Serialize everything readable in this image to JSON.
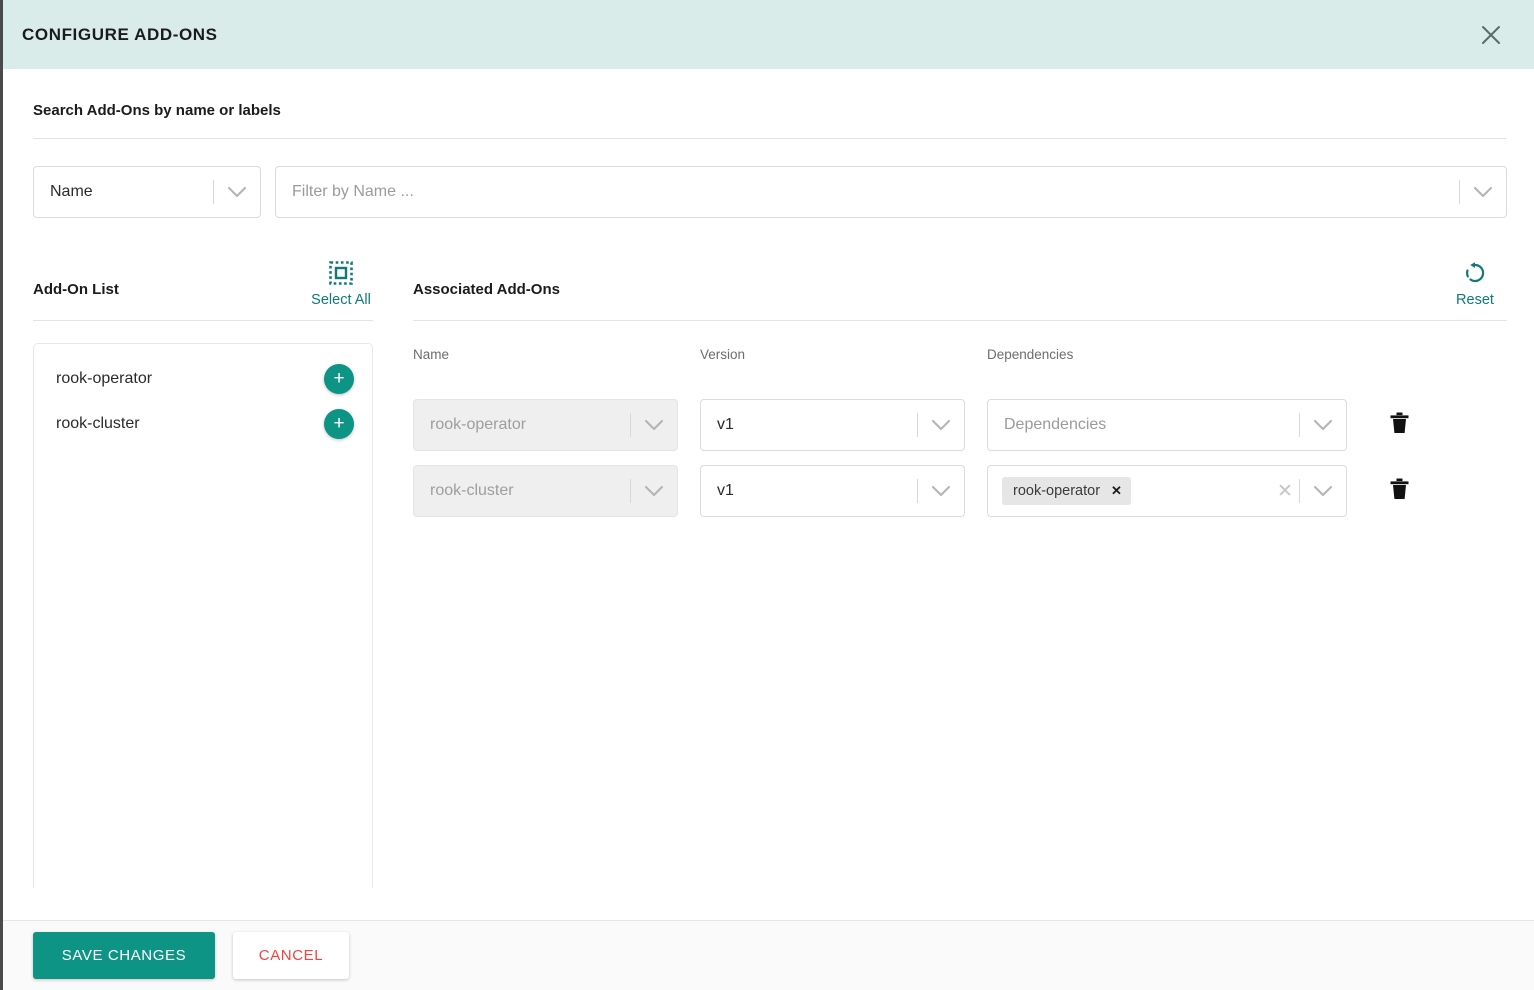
{
  "header": {
    "title": "CONFIGURE ADD-ONS",
    "close_icon": "close-icon"
  },
  "search": {
    "section_label": "Search Add-Ons by name or labels",
    "criteria_value": "Name",
    "criteria_caret_icon": "chevron-down-icon",
    "filter_placeholder": "Filter by Name ...",
    "filter_value": "",
    "filter_caret_icon": "chevron-down-icon"
  },
  "addon_list": {
    "title": "Add-On List",
    "select_all_label": "Select All",
    "select_all_icon": "select-all-icon",
    "items": [
      {
        "name": "rook-operator",
        "add_icon": "plus-icon"
      },
      {
        "name": "rook-cluster",
        "add_icon": "plus-icon"
      }
    ]
  },
  "associated": {
    "title": "Associated Add-Ons",
    "reset_label": "Reset",
    "reset_icon": "reset-icon",
    "columns": {
      "name": "Name",
      "version": "Version",
      "dependencies": "Dependencies"
    },
    "delete_icon": "trash-icon",
    "rows": [
      {
        "name": "rook-operator",
        "name_disabled": true,
        "version": "v1",
        "deps_placeholder": "Dependencies",
        "deps_chips": [],
        "has_clear": false
      },
      {
        "name": "rook-cluster",
        "name_disabled": true,
        "version": "v1",
        "deps_placeholder": "",
        "deps_chips": [
          {
            "label": "rook-operator",
            "remove_icon": "chip-remove-icon"
          }
        ],
        "has_clear": true
      }
    ]
  },
  "footer": {
    "save_label": "SAVE CHANGES",
    "cancel_label": "CANCEL"
  },
  "colors": {
    "header_bg": "#d9ecea",
    "accent_teal": "#0d9485",
    "link_teal": "#11787b",
    "danger_red": "#f4433c"
  }
}
